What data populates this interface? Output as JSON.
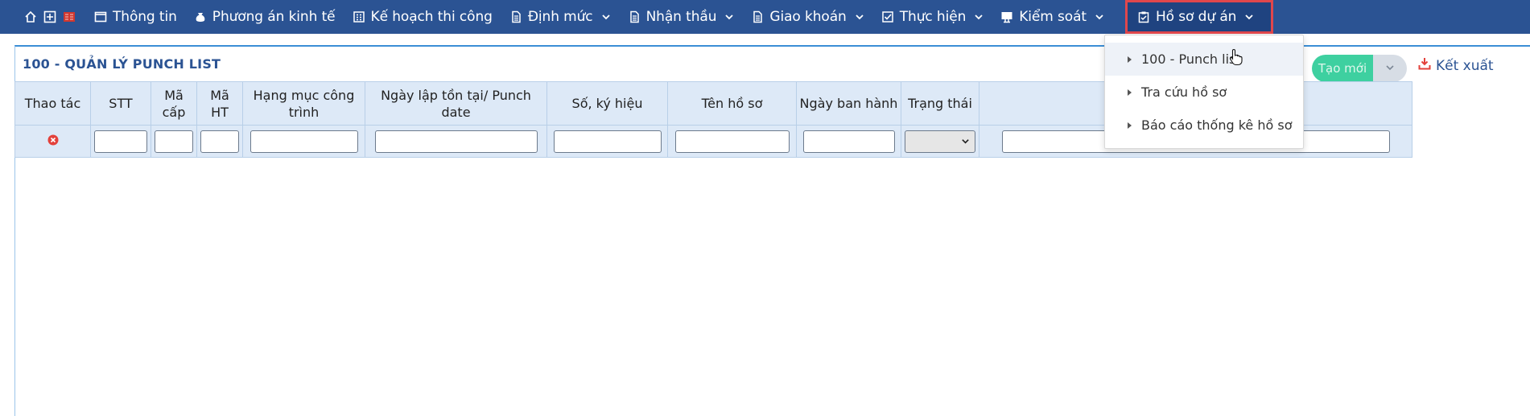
{
  "nav": {
    "items": [
      {
        "label": "Thông tin",
        "icon": "window-icon"
      },
      {
        "label": "Phương án kinh tế",
        "icon": "money-bag-icon"
      },
      {
        "label": "Kế hoạch thi công",
        "icon": "calendar-grid-icon"
      },
      {
        "label": "Định mức",
        "icon": "document-icon"
      },
      {
        "label": "Nhận thầu",
        "icon": "document-icon"
      },
      {
        "label": "Giao khoán",
        "icon": "document-icon"
      },
      {
        "label": "Thực hiện",
        "icon": "checkbox-icon"
      },
      {
        "label": "Kiểm soát",
        "icon": "monitor-icon"
      },
      {
        "label": "Hồ sơ dự án",
        "icon": "clipboard-check-icon"
      }
    ]
  },
  "page": {
    "title": "100 - QUẢN LÝ PUNCH LIST"
  },
  "actions": {
    "new_label": "Tạo mới",
    "export_label": "Kết xuất"
  },
  "table": {
    "headers": [
      "Thao tác",
      "STT",
      "Mã cấp",
      "Mã HT",
      "Hạng mục công trình",
      "Ngày lập tồn tại/ Punch date",
      "Số, ký hiệu",
      "Tên hồ sơ",
      "Ngày ban hành",
      "Trạng thái",
      ""
    ]
  },
  "dropdown": {
    "items": [
      "100 - Punch list",
      "Tra cứu hồ sơ",
      "Báo cáo thống kê hồ sơ"
    ]
  },
  "colors": {
    "navbar": "#2b5393",
    "active_outline": "#e0474c",
    "primary_button": "#3ed0a0",
    "header_bg": "#dde9f7",
    "title": "#2b5393"
  }
}
